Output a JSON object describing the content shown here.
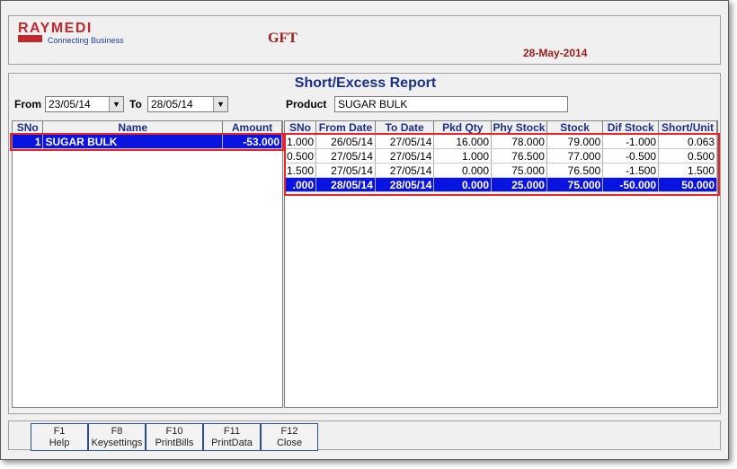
{
  "header": {
    "logo_text": "RAYMEDI",
    "logo_tagline": "Connecting Business",
    "company": "GFT",
    "date": "28-May-2014"
  },
  "report": {
    "title": "Short/Excess Report",
    "from_label": "From",
    "from_value": "23/05/14",
    "to_label": "To",
    "to_value": "28/05/14",
    "product_label": "Product",
    "product_value": "SUGAR BULK"
  },
  "left_table": {
    "columns": [
      "SNo",
      "Name",
      "Amount"
    ],
    "rows": [
      [
        "1",
        "SUGAR BULK",
        "-53.000"
      ]
    ]
  },
  "right_table": {
    "columns": [
      "SNo",
      "From Date",
      "To Date",
      "Pkd Qty",
      "Phy Stock",
      "Stock",
      "Dif Stock",
      "Short/Unit"
    ],
    "rows": [
      [
        "1.000",
        "26/05/14",
        "27/05/14",
        "16.000",
        "78.000",
        "79.000",
        "-1.000",
        "0.063"
      ],
      [
        "0.500",
        "27/05/14",
        "27/05/14",
        "1.000",
        "76.500",
        "77.000",
        "-0.500",
        "0.500"
      ],
      [
        "1.500",
        "27/05/14",
        "27/05/14",
        "0.000",
        "75.000",
        "76.500",
        "-1.500",
        "1.500"
      ],
      [
        ".000",
        "28/05/14",
        "28/05/14",
        "0.000",
        "25.000",
        "75.000",
        "-50.000",
        "50.000"
      ]
    ]
  },
  "fkeys": [
    {
      "key": "F1",
      "label": "Help"
    },
    {
      "key": "F8",
      "label": "Keysettings"
    },
    {
      "key": "F10",
      "label": "PrintBills"
    },
    {
      "key": "F11",
      "label": "PrintData"
    },
    {
      "key": "F12",
      "label": "Close"
    }
  ],
  "colors": {
    "selection": "#0a14e0",
    "highlight_border": "#e8232a",
    "title_blue": "#1a2f8a",
    "header_red": "#9b1c1c"
  }
}
